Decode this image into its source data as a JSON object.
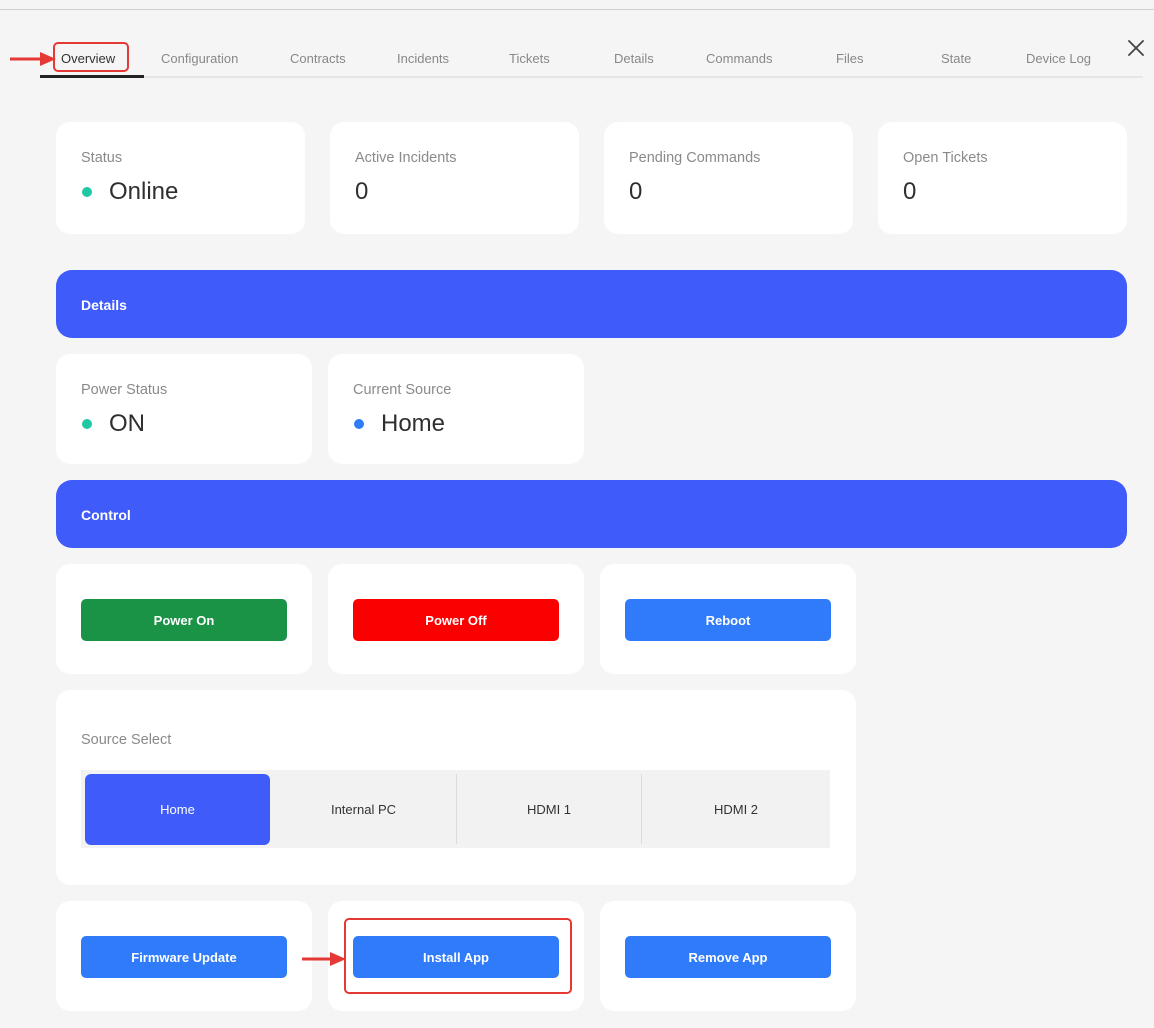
{
  "tabs": [
    {
      "label": "Overview",
      "active": true
    },
    {
      "label": "Configuration"
    },
    {
      "label": "Contracts"
    },
    {
      "label": "Incidents"
    },
    {
      "label": "Tickets"
    },
    {
      "label": "Details"
    },
    {
      "label": "Commands"
    },
    {
      "label": "Files"
    },
    {
      "label": "State"
    },
    {
      "label": "Device Log"
    }
  ],
  "close_icon": "close-icon",
  "summary": [
    {
      "label": "Status",
      "value": "Online",
      "dot_color": "#1ec8a5"
    },
    {
      "label": "Active Incidents",
      "value": "0"
    },
    {
      "label": "Pending Commands",
      "value": "0"
    },
    {
      "label": "Open Tickets",
      "value": "0"
    }
  ],
  "details": {
    "title": "Details",
    "items": [
      {
        "label": "Power Status",
        "value": "ON",
        "dot_color": "#1ec8a5"
      },
      {
        "label": "Current Source",
        "value": "Home",
        "dot_color": "#2f7bfa"
      }
    ]
  },
  "control": {
    "title": "Control",
    "power_on": "Power On",
    "power_off": "Power Off",
    "reboot": "Reboot",
    "source_select": {
      "label": "Source Select",
      "options": [
        "Home",
        "Internal PC",
        "HDMI 1",
        "HDMI 2"
      ],
      "selected": "Home"
    },
    "firmware_update": "Firmware Update",
    "install_app": "Install App",
    "remove_app": "Remove App"
  },
  "colors": {
    "accent": "#3f5bfa",
    "button_blue": "#2f7bfa",
    "button_green": "#1a9347",
    "button_red": "#fa0000",
    "annotation_red": "#e53935"
  }
}
